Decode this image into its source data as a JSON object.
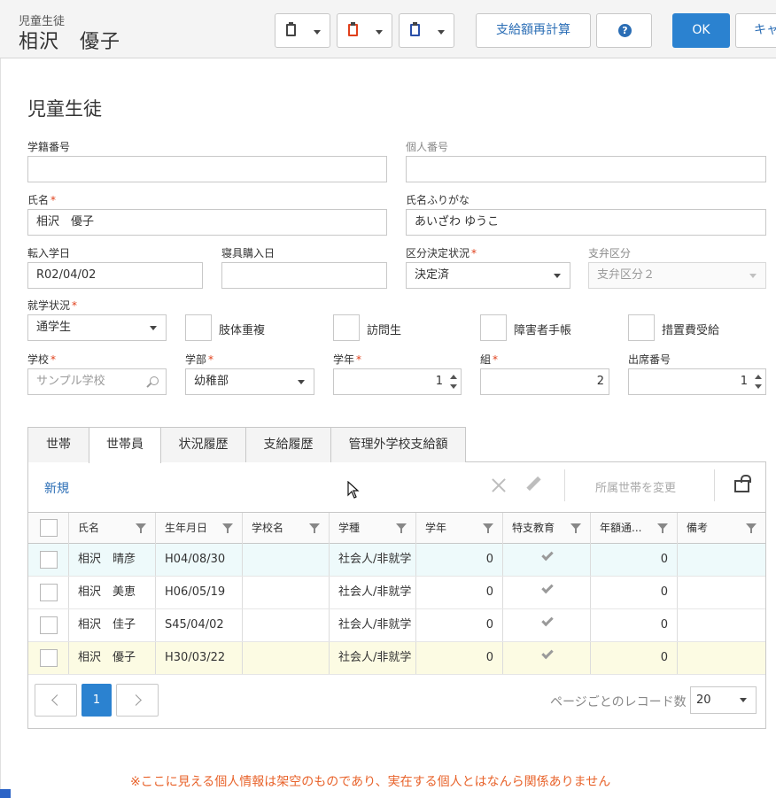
{
  "header": {
    "subtitle": "児童生徒",
    "name": "相沢　優子",
    "btn_recalc": "支給額再計算",
    "btn_ok": "OK",
    "btn_cancel": "キャ",
    "help_glyph": "?",
    "clip_colors": [
      "#444444",
      "#e0401c",
      "#2a4fa8"
    ]
  },
  "form": {
    "title": "児童生徒",
    "required_mark": "*",
    "student_no_label": "学籍番号",
    "personal_no_label": "個人番号",
    "name_label": "氏名",
    "name_value": "相沢　優子",
    "kana_label": "氏名ふりがな",
    "kana_value": "あいざわ ゆうこ",
    "transfer_date_label": "転入学日",
    "transfer_date_value": "R02/04/02",
    "bedding_date_label": "寝具購入日",
    "decision_label": "区分決定状況",
    "decision_value": "決定済",
    "payment_div_label": "支弁区分",
    "payment_div_value": "支弁区分２",
    "attendance_label": "就学状況",
    "attendance_value": "通学生",
    "checkbox_labels": [
      "肢体重複",
      "訪問生",
      "障害者手帳",
      "措置費受給"
    ],
    "school_label": "学校",
    "school_placeholder": "サンプル学校",
    "dept_label": "学部",
    "dept_value": "幼稚部",
    "grade_label": "学年",
    "grade_value": "1",
    "class_label": "組",
    "class_value": "2",
    "seat_label": "出席番号",
    "seat_value": "1"
  },
  "tabs": [
    "世帯",
    "世帯員",
    "状況履歴",
    "支給履歴",
    "管理外学校支給額"
  ],
  "active_tab": "世帯員",
  "toolbar": {
    "new_label": "新規",
    "move_label": "所属世帯を変更"
  },
  "grid": {
    "columns": [
      "氏名",
      "生年月日",
      "学校名",
      "学種",
      "学年",
      "特支教育",
      "年額通...",
      "備考"
    ],
    "rows": [
      {
        "name": "相沢　晴彦",
        "dob": "H04/08/30",
        "school": "",
        "type": "社会人/非就学",
        "grade": "0",
        "special": true,
        "annual": "0",
        "note": "",
        "bg": "#eefafb"
      },
      {
        "name": "相沢　美恵",
        "dob": "H06/05/19",
        "school": "",
        "type": "社会人/非就学",
        "grade": "0",
        "special": true,
        "annual": "0",
        "note": "",
        "bg": "#ffffff"
      },
      {
        "name": "相沢　佳子",
        "dob": "S45/04/02",
        "school": "",
        "type": "社会人/非就学",
        "grade": "0",
        "special": true,
        "annual": "0",
        "note": "",
        "bg": "#ffffff"
      },
      {
        "name": "相沢　優子",
        "dob": "H30/03/22",
        "school": "",
        "type": "社会人/非就学",
        "grade": "0",
        "special": true,
        "annual": "0",
        "note": "",
        "bg": "#fcfbe3"
      }
    ]
  },
  "pager": {
    "current_page": "1",
    "page_size_label": "ページごとのレコード数",
    "page_size": "20"
  },
  "disclaimer": "※ここに見える個人情報は架空のものであり、実在する個人とはなんら関係ありません"
}
